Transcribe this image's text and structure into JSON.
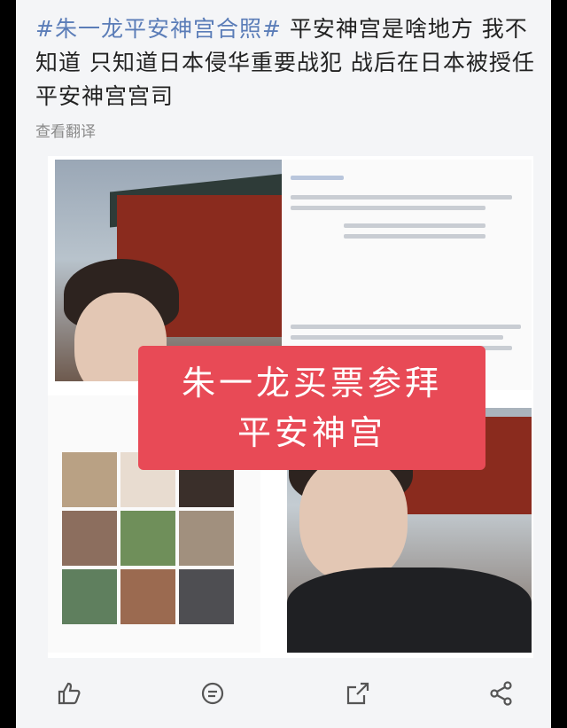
{
  "post": {
    "topic": "#朱一龙平安神宫合照#",
    "body": " 平安神宫是啥地方 我不知道 只知道日本侵华重要战犯 战后在日本被授任平安神宫宫司",
    "translate_label": "查看翻译"
  },
  "collage": {
    "banner_line1": "朱一龙买票参拜",
    "banner_line2": "平安神宫"
  },
  "actions": {
    "like_icon": "thumbs-up-icon",
    "comment_icon": "comment-icon",
    "repost_icon": "repost-icon",
    "share_icon": "share-icon"
  }
}
